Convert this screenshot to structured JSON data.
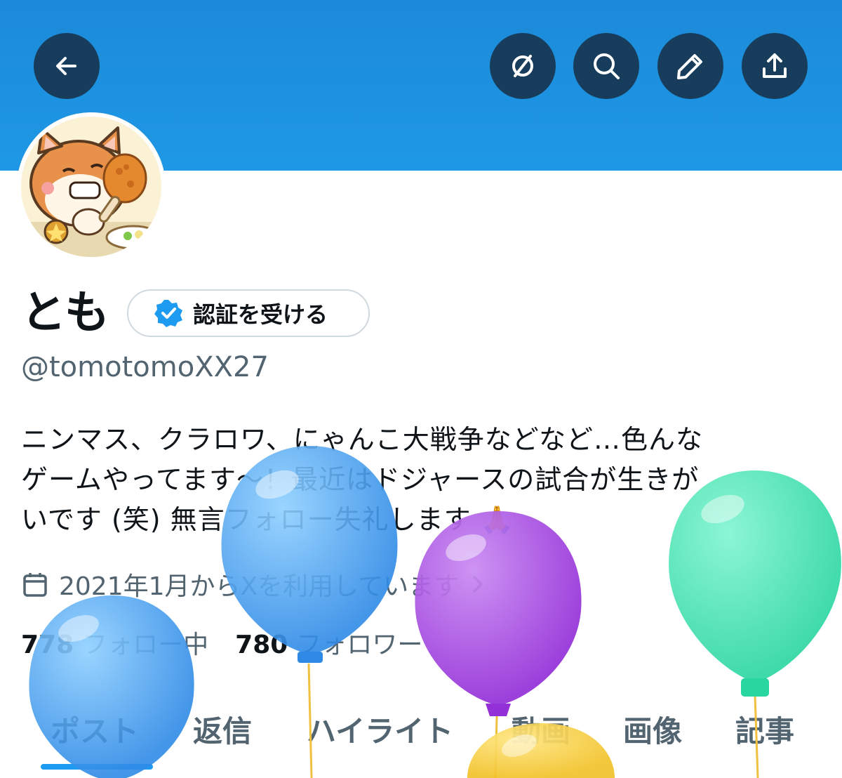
{
  "header": {
    "back_icon": "arrow-left-icon",
    "actions": [
      "grok-icon",
      "search-icon",
      "pencil-icon",
      "share-icon"
    ],
    "banner_color": "#1e98e6"
  },
  "profile": {
    "avatar_alt": "shiba-dog-eating-fried-chicken",
    "display_name": "とも",
    "verify_label": "認証を受ける",
    "handle": "@tomotomoXX27",
    "bio_lines": [
      "ニンマス、クラロワ、にゃんこ大戦争などなど…色んな",
      "ゲームやってます〜！最近はドジャースの試合が生きが",
      "いです (笑) 無言フォロー失礼します 🙏"
    ],
    "joined": "2021年1月からXを利用しています",
    "following_count": "778",
    "following_label": "フォロー中",
    "followers_count": "780",
    "followers_label": "フォロワー"
  },
  "tabs": [
    "ポスト",
    "返信",
    "ハイライト",
    "動画",
    "画像",
    "記事"
  ],
  "colors": {
    "accent": "#1d9bf0",
    "balloon_blue": "#4aa8f0",
    "balloon_purple": "#a64be3",
    "balloon_green": "#3fe0b0",
    "balloon_yellow": "#f6cf3a"
  }
}
